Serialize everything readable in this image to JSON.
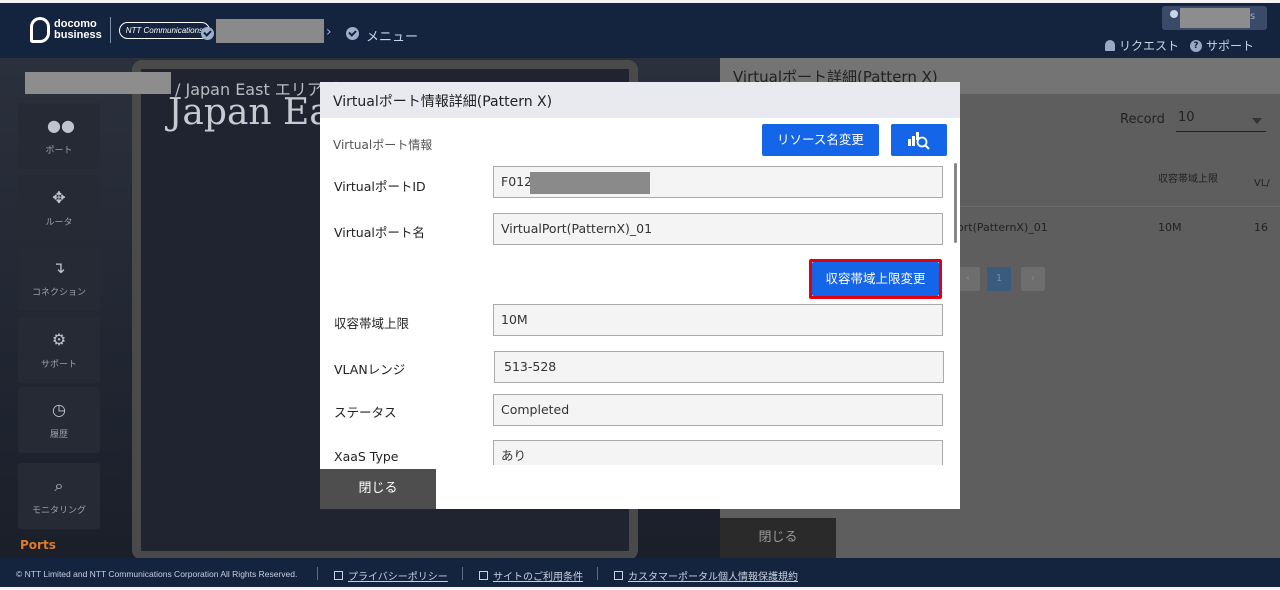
{
  "header": {
    "logo_line1": "docomo",
    "logo_line2": "business",
    "ntt_label": "NTT Communications",
    "crumb_menu": "メニュー",
    "user_suffix": "s",
    "request_label": "リクエスト",
    "support_label": "サポート"
  },
  "background": {
    "breadcrumb_area": "/ Japan East エリアビ",
    "big_title": "Japan Eas",
    "sidebar": [
      {
        "label": "ポート",
        "icon": "port-icon"
      },
      {
        "label": "ルータ",
        "icon": "router-icon"
      },
      {
        "label": "コネクション",
        "icon": "connection-icon"
      },
      {
        "label": "サポート",
        "icon": "support-gear-icon"
      },
      {
        "label": "履歴",
        "icon": "history-icon"
      },
      {
        "label": "モニタリング",
        "icon": "monitoring-icon"
      }
    ],
    "ports_label": "Ports",
    "right_panel": {
      "title": "Virtualポート詳細(Pattern X)",
      "record_label": "Record",
      "record_value": "10",
      "col_bandwidth": "収容帯域上限",
      "col_vlan": "VL/",
      "row_name": "ort(PatternX)_01",
      "row_bandwidth": "10M",
      "row_vlan": "16",
      "page_prev": "‹",
      "page_current": "1",
      "page_next": "›",
      "close_label": "閉じる"
    }
  },
  "modal": {
    "title": "Virtualポート情報詳細(Pattern X)",
    "section_label": "Virtualポート情報",
    "rename_button": "リソース名変更",
    "bandwidth_change_button": "収容帯域上限変更",
    "fields": {
      "port_id_label": "VirtualポートID",
      "port_id_value": "F012",
      "port_name_label": "Virtualポート名",
      "port_name_value": "VirtualPort(PatternX)_01",
      "bandwidth_label": "収容帯域上限",
      "bandwidth_value": "10M",
      "vlan_label": "VLANレンジ",
      "vlan_value": "513-528",
      "status_label": "ステータス",
      "status_value": "Completed",
      "xaas_label": "XaaS Type",
      "xaas_value": "あり"
    },
    "close_label": "閉じる"
  },
  "footer": {
    "copyright": "© NTT Limited and NTT Communications Corporation All Rights Reserved.",
    "privacy": "プライバシーポリシー",
    "terms": "サイトのご利用条件",
    "customer_portal": "カスタマーポータル個人情報保護規約"
  },
  "colors": {
    "header_bg": "#14233e",
    "primary_button": "#1565e8",
    "highlight_border": "#e00012",
    "ports_accent": "#e07a2a"
  }
}
